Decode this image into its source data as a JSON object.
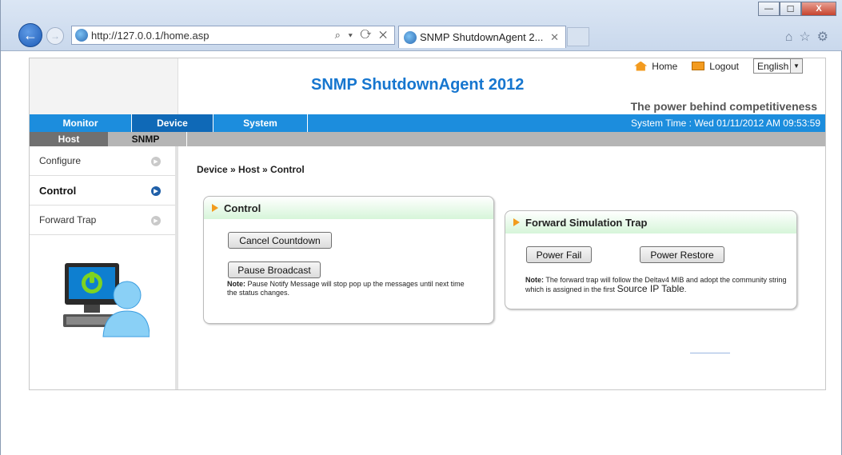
{
  "browser": {
    "url": "http://127.0.0.1/home.asp",
    "tab_title": "SNMP ShutdownAgent 2...",
    "addr_tools": "⌕ ▾ ⟳ ✕",
    "win_buttons": [
      "—",
      "☐",
      "X"
    ]
  },
  "header": {
    "title": "SNMP ShutdownAgent 2012",
    "tagline": "The power behind competitiveness",
    "home_link": "Home",
    "logout_link": "Logout",
    "language": "English"
  },
  "nav": {
    "items": [
      "Monitor",
      "Device",
      "System"
    ],
    "active": "Device",
    "system_time": "System Time : Wed 01/11/2012 AM 09:53:59"
  },
  "subnav": {
    "items": [
      "Host",
      "SNMP"
    ],
    "active": "Host"
  },
  "sidebar": {
    "items": [
      "Configure",
      "Control",
      "Forward Trap"
    ],
    "active": "Control"
  },
  "content": {
    "breadcrumb": "Device » Host » Control",
    "control_panel": {
      "title": "Control",
      "cancel_label": "Cancel Countdown",
      "pause_label": "Pause Broadcast",
      "note_prefix": "Note:",
      "note_text": " Pause Notify Message will stop pop up the messages until next time the status changes."
    },
    "trap_panel": {
      "title": "Forward Simulation Trap",
      "power_fail_label": "Power Fail",
      "power_restore_label": "Power Restore",
      "note_prefix": "Note:",
      "note_text": " The forward trap will follow the Deltav4 MIB and adopt the community string which is assigned in the first ",
      "note_link": "Source IP Table",
      "note_end": "."
    }
  },
  "colors": {
    "nav_blue": "#1c8ddd",
    "title_blue": "#1676cf",
    "accent_orange": "#f29b1c",
    "panel_green": "#d6f5d9"
  }
}
